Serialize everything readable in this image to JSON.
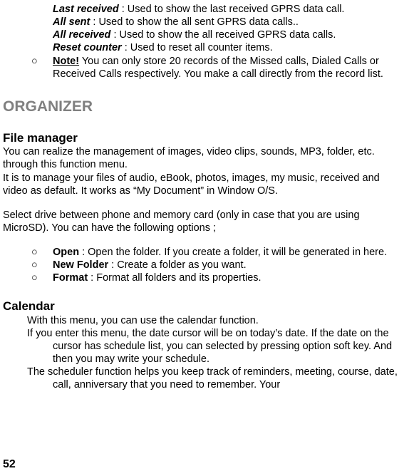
{
  "top": {
    "last_received_label": "Last received",
    "last_received_text": " : Used to show the last received GPRS data call.",
    "all_sent_label": "All sent",
    "all_sent_text": " : Used to show the all sent GPRS data calls..",
    "all_received_label": "All received",
    "all_received_text": " : Used to show the all received GPRS data calls.",
    "reset_label": "Reset counter",
    "reset_text": " : Used to reset all counter items.",
    "note_bullet": "○",
    "note_label": "Note!",
    "note_text": "    You can only store 20 records of the Missed calls, Dialed Calls or Received Calls respectively. You make a call directly from the record list."
  },
  "organizer_heading": "ORGANIZER",
  "file_manager": {
    "heading": "File manager",
    "p1": "You can realize the management of images, video clips, sounds, MP3, folder, etc. through this function menu.",
    "p2": "It is to manage your files of audio, eBook, photos, images, my music, received and video as default. It works as “My Document” in Window O/S.",
    "p3": "Select drive between phone and memory card (only in case that you are using MicroSD). You can have the following options ;",
    "bullet": "○",
    "items": [
      {
        "label": "Open",
        "text": " : Open the folder. If you create a folder, it will be generated in here."
      },
      {
        "label": "New Folder",
        "text": " : Create a folder as you want."
      },
      {
        "label": "Format",
        "text": " : Format all folders and its properties."
      }
    ]
  },
  "calendar": {
    "heading": "Calendar",
    "p1": "With this menu, you can use the calendar function.",
    "p2": "If you enter this menu, the date cursor will be on today’s date. If the date on the cursor has schedule list, you can selected by pressing option soft key. And then you may write your schedule.",
    "p3": "The scheduler function helps you keep track of reminders, meeting, course, date, call, anniversary that you need to remember. Your"
  },
  "page_number": "52"
}
